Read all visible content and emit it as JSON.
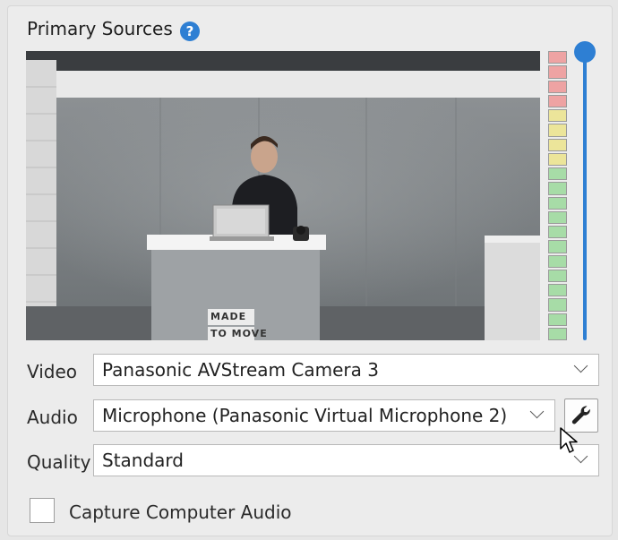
{
  "section_title": "Primary Sources",
  "help_icon": "question-circle-icon",
  "video": {
    "label": "Video",
    "value": "Panasonic AVStream Camera 3"
  },
  "audio": {
    "label": "Audio",
    "value": "Microphone (Panasonic Virtual Microphone 2)"
  },
  "quality": {
    "label": "Quality",
    "value": "Standard"
  },
  "audio_settings_icon": "wrench-icon",
  "capture_audio": {
    "label": "Capture Computer Audio",
    "checked": false
  },
  "preview_sign_text": [
    "MADE",
    "TO MOVE"
  ],
  "level_meter": {
    "segments": 20,
    "red": 4,
    "yellow": 4,
    "green": 12
  },
  "volume_level": 1.0,
  "colors": {
    "accent": "#2e7fd3"
  }
}
